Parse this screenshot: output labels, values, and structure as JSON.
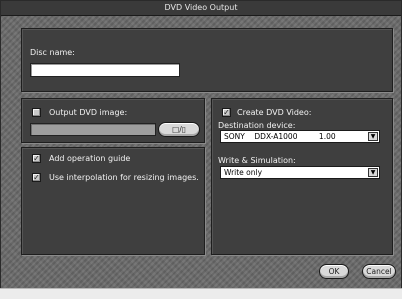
{
  "window": {
    "title": "DVD Video Output"
  },
  "disc": {
    "label": "Disc name:",
    "value": ""
  },
  "output_image": {
    "label": "Output DVD image:",
    "checked": false,
    "path": "",
    "browse_icon_text": "□/🗋"
  },
  "options": {
    "add_guide": {
      "label": "Add operation guide",
      "checked": true
    },
    "interpolation": {
      "label": "Use interpolation for resizing images.",
      "checked": true
    }
  },
  "create_video": {
    "label": "Create DVD Video:",
    "checked": true,
    "destination": {
      "label": "Destination device:",
      "value": "SONY    DDX-A1000         1.00"
    },
    "write_sim": {
      "label": "Write & Simulation:",
      "value": "Write only"
    }
  },
  "buttons": {
    "ok": "OK",
    "cancel": "Cancel"
  }
}
